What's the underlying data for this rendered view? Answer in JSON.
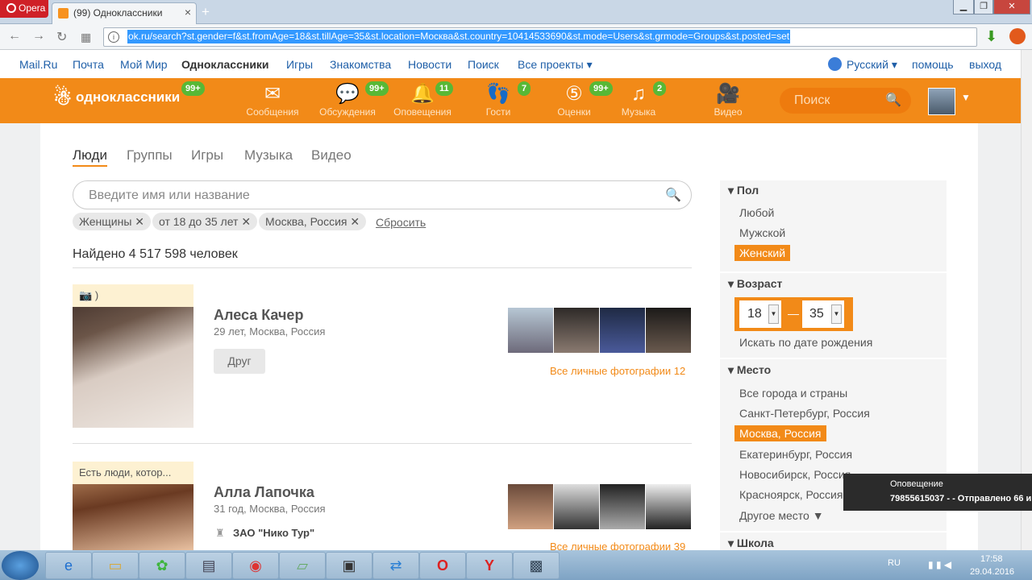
{
  "browser": {
    "opera_label": "Opera",
    "tab_title": "(99) Одноклассники",
    "url": "ok.ru/search?st.gender=f&st.fromAge=18&st.tillAge=35&st.location=Москва&st.country=10414533690&st.mode=Users&st.grmode=Groups&st.posted=set"
  },
  "portal": {
    "links": [
      "Mail.Ru",
      "Почта",
      "Мой Мир",
      "Одноклассники",
      "Игры",
      "Знакомства",
      "Новости",
      "Поиск",
      "Все проекты ▾"
    ],
    "language": "Русский ▾",
    "help": "помощь",
    "logout": "выход"
  },
  "toolbar": {
    "logo_text": "одноклассники",
    "logo_badge": "99+",
    "items": [
      {
        "label": "Сообщения",
        "icon": "envelope-icon",
        "badge": ""
      },
      {
        "label": "Обсуждения",
        "icon": "chat-icon",
        "badge": "99+"
      },
      {
        "label": "Оповещения",
        "icon": "bell-icon",
        "badge": "11"
      },
      {
        "label": "Гости",
        "icon": "footprints-icon",
        "badge": "7"
      },
      {
        "label": "Оценки",
        "icon": "rating-icon",
        "badge": "99+"
      },
      {
        "label": "Музыка",
        "icon": "music-icon",
        "badge": "2"
      },
      {
        "label": "Видео",
        "icon": "video-icon",
        "badge": ""
      }
    ],
    "search_placeholder": "Поиск"
  },
  "search": {
    "tabs": [
      "Люди",
      "Группы",
      "Игры",
      "Музыка",
      "Видео"
    ],
    "active_tab": "Люди",
    "placeholder": "Введите имя или название",
    "chips": [
      "Женщины",
      "от 18 до 35 лет",
      "Москва, Россия"
    ],
    "reset": "Сбросить",
    "found": "Найдено 4 517 598 человек"
  },
  "results": [
    {
      "photo_caption": ")",
      "name": "Алеса Качер",
      "meta": "29 лет, Москва, Россия",
      "button": "Друг",
      "all_photos": "Все личные фотографии 12"
    },
    {
      "photo_caption": "Есть люди, котор...",
      "name": "Алла Лапочка",
      "meta": "31 год, Москва, Россия",
      "work": "ЗАО \"Нико Тур\"",
      "all_photos": "Все личные фотографии 39"
    }
  ],
  "filters": {
    "gender_title": "Пол",
    "gender_options": [
      "Любой",
      "Мужской",
      "Женский"
    ],
    "gender_selected": "Женский",
    "age_title": "Возраст",
    "age_from": "18",
    "age_to": "35",
    "age_dash": "—",
    "birthdate": "Искать по дате рождения",
    "place_title": "Место",
    "places": [
      "Все города и страны",
      "Санкт-Петербург, Россия",
      "Москва, Россия",
      "Екатеринбург, Россия",
      "Новосибирск, Россия",
      "Красноярск, Россия",
      "Другое место ▼"
    ],
    "place_selected": "Москва, Россия",
    "school_title": "Школа"
  },
  "notification": {
    "title": "Оповещение",
    "text": "79855615037 -  - Отправлено 66 и"
  },
  "taskbar": {
    "lang": "RU",
    "time": "17:58",
    "date": "29.04.2016"
  }
}
